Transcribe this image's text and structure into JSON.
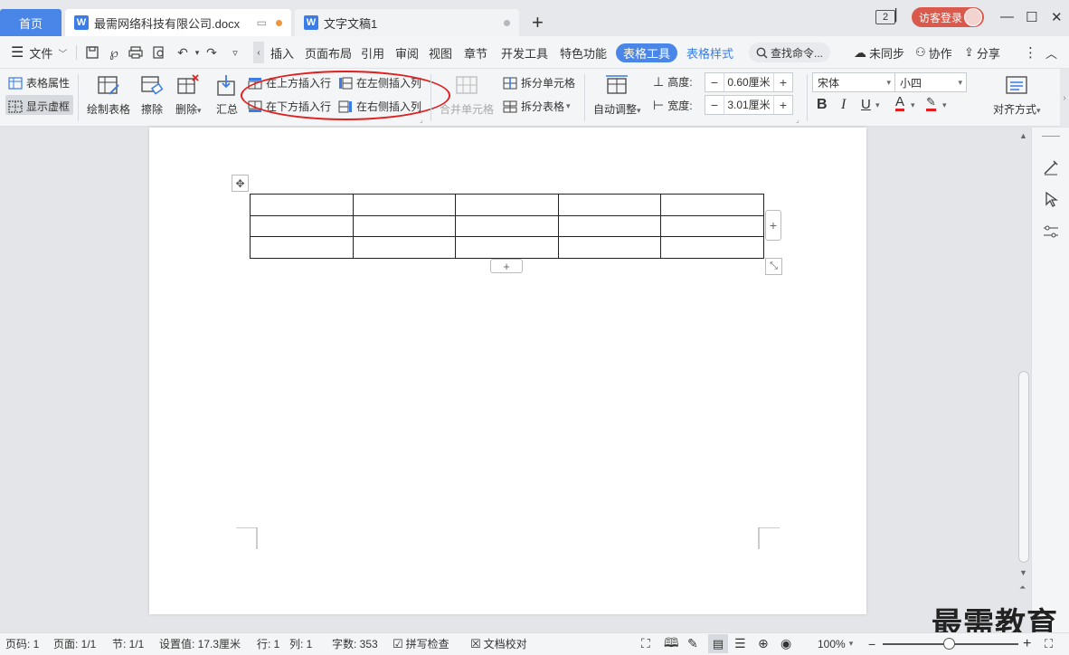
{
  "tabs": {
    "home": "首页",
    "active_doc": "最需网络科技有限公司.docx",
    "second_doc": "文字文稿1",
    "window_count": "2",
    "login": "访客登录"
  },
  "menu": {
    "file": "文件",
    "items": [
      "插入",
      "页面布局",
      "引用",
      "审阅",
      "视图",
      "章节",
      "开发工具",
      "特色功能"
    ],
    "active_tab": "表格工具",
    "table_style": "表格样式",
    "search": "查找命令...",
    "unsynced": "未同步",
    "collab": "协作",
    "share": "分享"
  },
  "ribbon": {
    "table_props": "表格属性",
    "show_gridlines": "显示虚框",
    "draw_table": "绘制表格",
    "erase": "擦除",
    "delete": "删除",
    "summary": "汇总",
    "insert_above": "在上方插入行",
    "insert_below": "在下方插入行",
    "insert_left": "在左侧插入列",
    "insert_right": "在右侧插入列",
    "merge_cells": "合并单元格",
    "split_cells": "拆分单元格",
    "split_table": "拆分表格",
    "auto_fit": "自动调整",
    "height_label": "高度:",
    "height_value": "0.60厘米",
    "width_label": "宽度:",
    "width_value": "3.01厘米",
    "font_name": "宋体",
    "font_size": "小四",
    "align": "对齐方式"
  },
  "status": {
    "page_num": "页码: 1",
    "pages": "页面: 1/1",
    "section": "节: 1/1",
    "setting": "设置值: 17.3厘米",
    "row": "行: 1",
    "col": "列: 1",
    "words": "字数: 353",
    "spell": "拼写检查",
    "proof": "文档校对",
    "zoom": "100%"
  },
  "table": {
    "rows": 3,
    "cols": 5
  },
  "watermark": "最需教育",
  "colors": {
    "accent": "#4a86e8",
    "login": "#d95a4c",
    "annotation": "#e02020"
  }
}
